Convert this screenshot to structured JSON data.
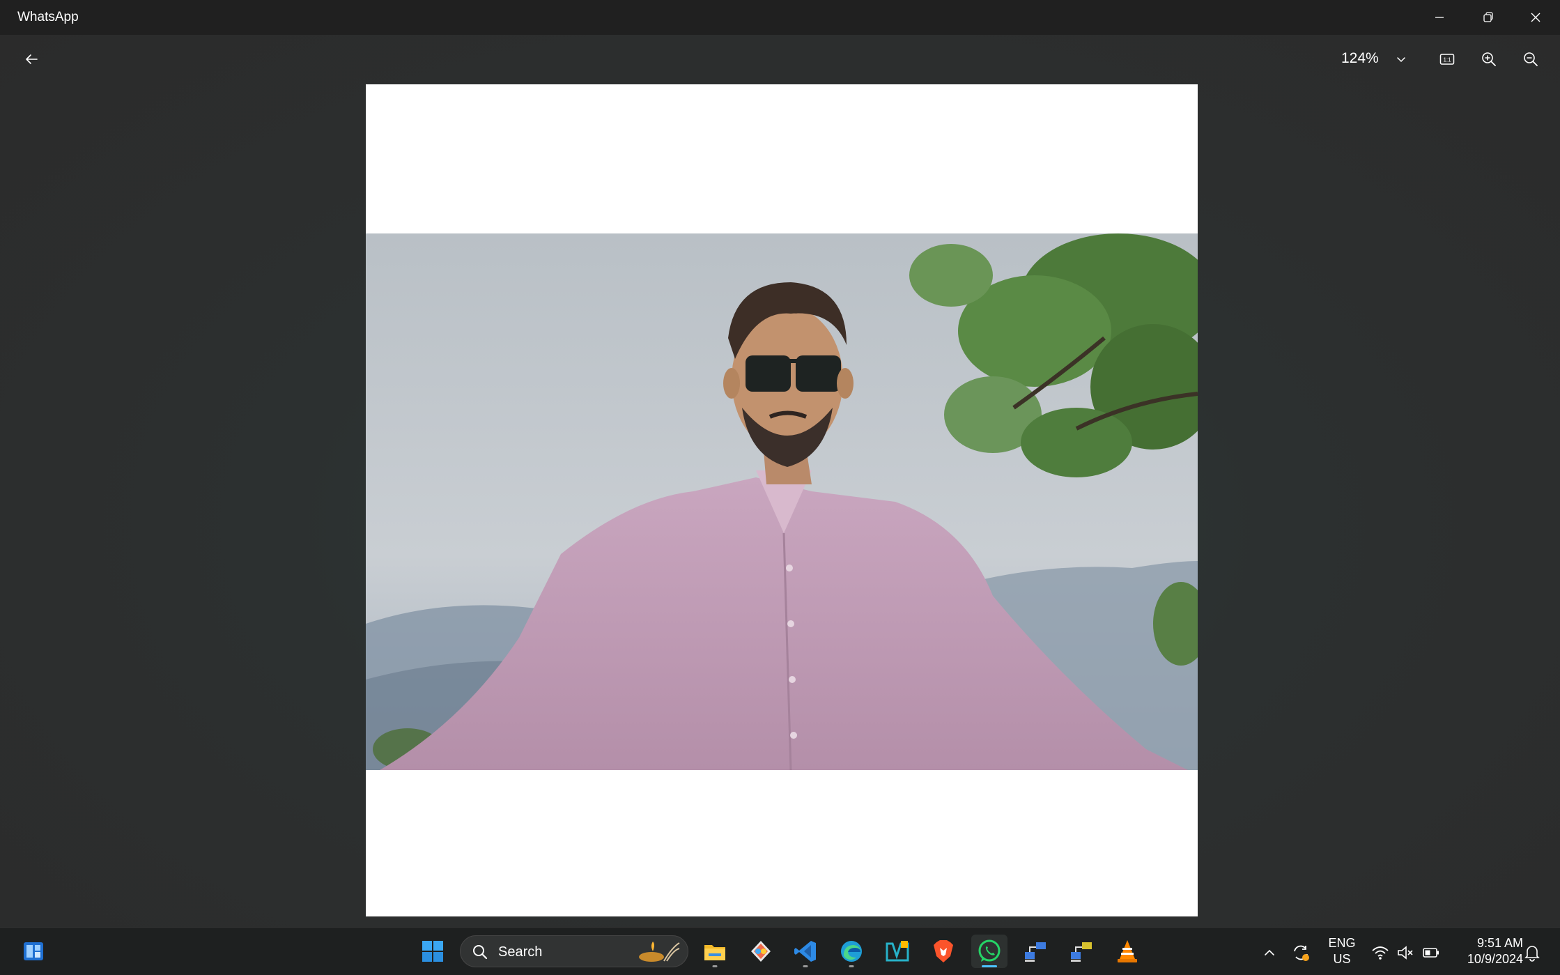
{
  "window": {
    "title": "WhatsApp"
  },
  "toolbar": {
    "zoom_level": "124%",
    "actual_size_label": "1:1"
  },
  "image": {
    "description_icon": "photo"
  },
  "taskbar": {
    "search_placeholder": "Search",
    "lang_top": "ENG",
    "lang_bottom": "US",
    "time": "9:51 AM",
    "date": "10/9/2024"
  },
  "icons": {
    "back": "back-arrow-icon",
    "minimize": "minimize-icon",
    "restore": "restore-icon",
    "close": "close-icon",
    "chevron": "chevron-down-icon",
    "actual_size": "actual-size-icon",
    "zoom_in": "zoom-in-icon",
    "zoom_out": "zoom-out-icon"
  },
  "colors": {
    "accent": "#4cc2ff",
    "whatsapp": "#25d366"
  }
}
